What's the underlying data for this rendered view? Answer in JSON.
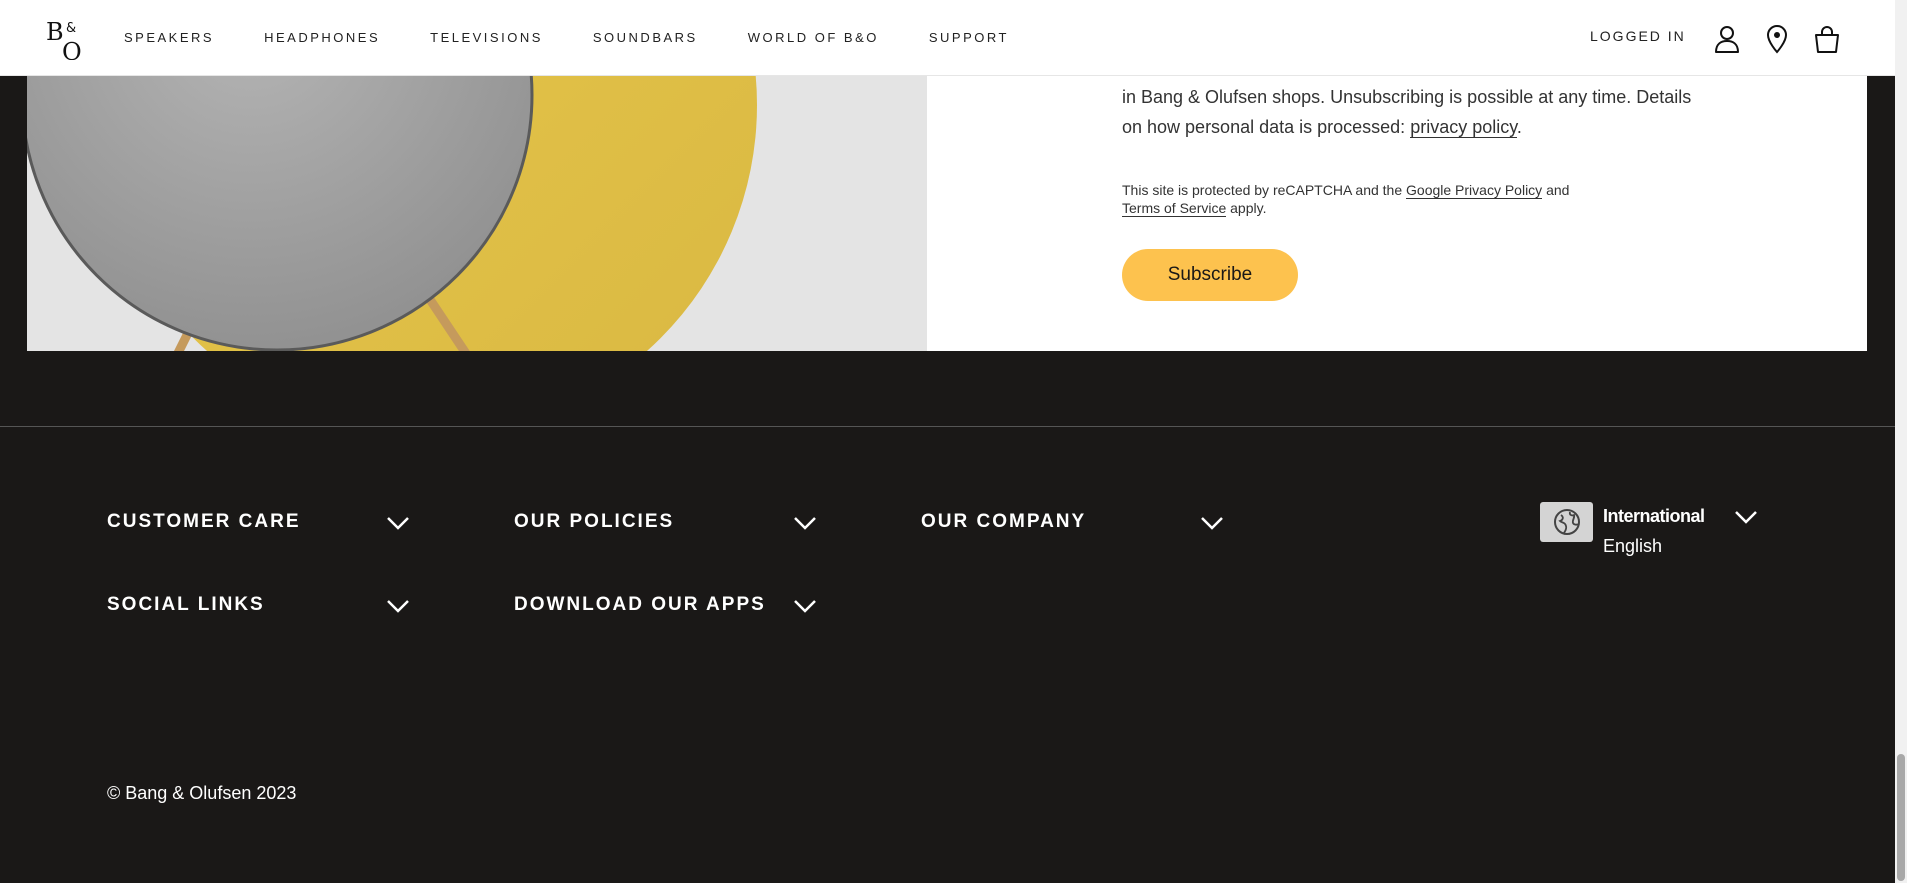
{
  "header": {
    "logo_alt": "B&O",
    "nav": [
      "SPEAKERS",
      "HEADPHONES",
      "TELEVISIONS",
      "SOUNDBARS",
      "WORLD OF B&O",
      "SUPPORT"
    ],
    "logged_in": "LOGGED IN",
    "icons": [
      "user-icon",
      "location-pin-icon",
      "shopping-bag-icon"
    ]
  },
  "newsletter": {
    "para_line1": "in Bang & Olufsen shops. Unsubscribing is possible at any time. Details",
    "para_line2_prefix": "on how personal data is processed: ",
    "privacy_link": "privacy policy",
    "para_line2_suffix": ".",
    "recaptcha_prefix": "This site is protected by reCAPTCHA and the ",
    "google_privacy": "Google Privacy Policy",
    "recaptcha_and": " and",
    "terms": "Terms of Service",
    "recaptcha_suffix": " apply.",
    "subscribe_label": "Subscribe",
    "button_color": "#fdc24e"
  },
  "footer": {
    "sections": {
      "customer_care": "CUSTOMER CARE",
      "our_policies": "OUR POLICIES",
      "our_company": "OUR COMPANY",
      "social_links": "SOCIAL LINKS",
      "download_apps": "DOWNLOAD OUR APPS"
    },
    "region": "International",
    "language": "English",
    "copyright": "© Bang & Olufsen 2023",
    "background": "#1a1817"
  }
}
